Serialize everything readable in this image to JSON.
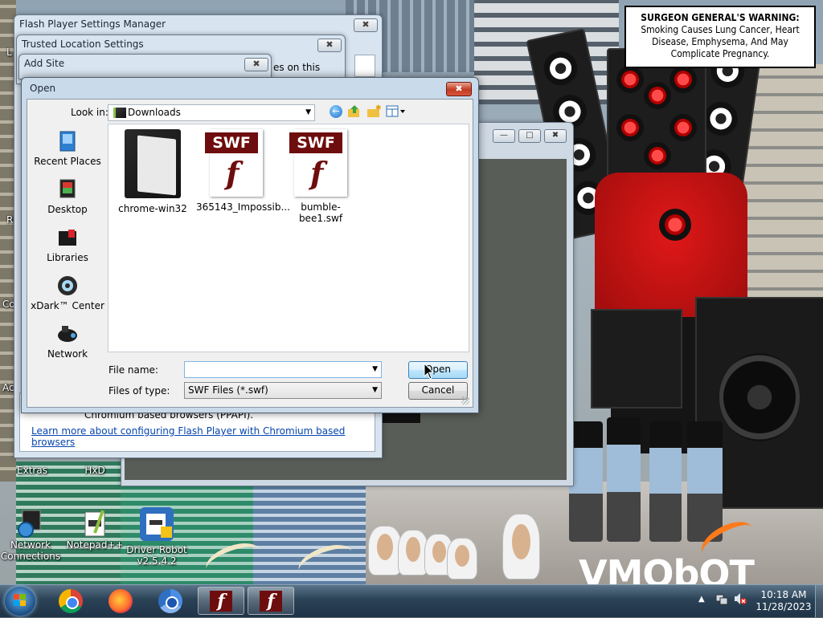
{
  "warning": {
    "title": "SURGEON GENERAL'S WARNING:",
    "body": "Smoking Causes Lung Cancer, Heart Disease, Emphysema, And May Complicate Pregnancy."
  },
  "brand_text": "VMObOT",
  "desktop_icons": {
    "extras": "Extras",
    "hxd": "HxD",
    "network_connections": "Network Connections",
    "notepadpp": "Notepad++",
    "driver_robot": "Driver Robot v2.5.4.2",
    "cut_labels": [
      "L",
      "R",
      "Co",
      "Ac"
    ]
  },
  "windows": {
    "settings_manager_title": "Flash Player Settings Manager",
    "trusted_location_title": "Trusted Location Settings",
    "add_site_title": "Add Site",
    "partial_text": "es on this",
    "chromium_text": "Chromium based browsers (PPAPI).",
    "chromium_link": "Learn more about configuring Flash Player with Chromium based browsers"
  },
  "open_dialog": {
    "title": "Open",
    "look_in_label": "Look in:",
    "look_in_value": "Downloads",
    "places": [
      "Recent Places",
      "Desktop",
      "Libraries",
      "xDark™ Center",
      "Network"
    ],
    "files": [
      {
        "name": "chrome-win32",
        "type": "folder"
      },
      {
        "name": "365143_Impossib...",
        "type": "swf"
      },
      {
        "name": "bumble-bee1.swf",
        "type": "swf"
      }
    ],
    "swf_tag": "SWF",
    "flash_glyph": "f",
    "file_name_label": "File name:",
    "file_name_value": "",
    "files_of_type_label": "Files of type:",
    "files_of_type_value": "SWF Files (*.swf)",
    "open_button": "Open",
    "cancel_button": "Cancel"
  },
  "taskbar": {
    "time": "10:18 AM",
    "date": "11/28/2023"
  }
}
